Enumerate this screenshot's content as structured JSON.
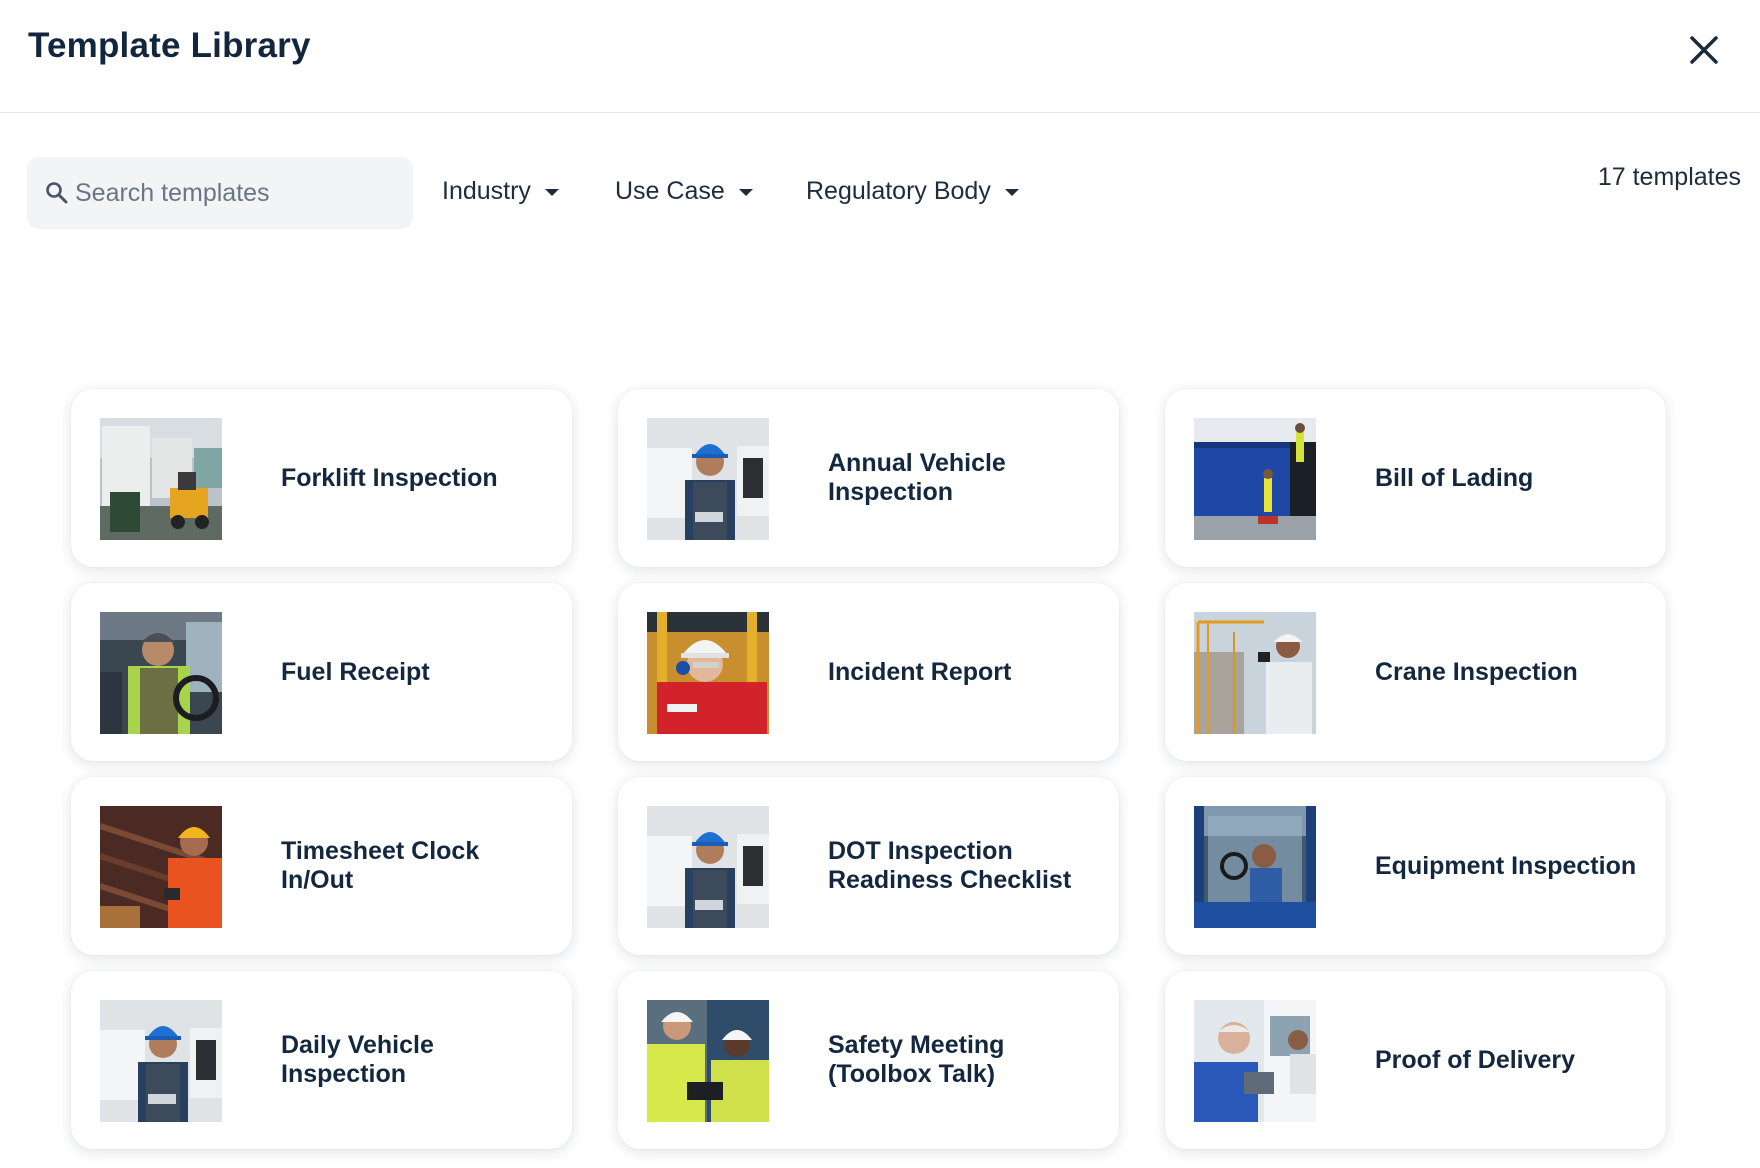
{
  "header": {
    "title": "Template Library"
  },
  "toolbar": {
    "search_placeholder": "Search templates",
    "search_value": "",
    "filters": [
      {
        "label": "Industry"
      },
      {
        "label": "Use Case"
      },
      {
        "label": "Regulatory Body"
      }
    ],
    "count_label": "17 templates"
  },
  "templates": [
    {
      "title": "Forklift Inspection",
      "image": "forklift-photo"
    },
    {
      "title": "Annual Vehicle Inspection",
      "image": "worker-hardhat-tablet-photo"
    },
    {
      "title": "Bill of Lading",
      "image": "truck-loading-photo"
    },
    {
      "title": "Fuel Receipt",
      "image": "truck-driver-photo"
    },
    {
      "title": "Incident Report",
      "image": "worker-red-jacket-photo"
    },
    {
      "title": "Crane Inspection",
      "image": "crane-site-photo"
    },
    {
      "title": "Timesheet Clock In/Out",
      "image": "worker-orange-photo"
    },
    {
      "title": "DOT Inspection Readiness Checklist",
      "image": "worker-hardhat-tablet-photo"
    },
    {
      "title": "Equipment Inspection",
      "image": "tractor-cab-photo"
    },
    {
      "title": "Daily Vehicle Inspection",
      "image": "worker-hardhat-tablet-photo"
    },
    {
      "title": "Safety Meeting (Toolbox Talk)",
      "image": "safety-meeting-photo"
    },
    {
      "title": "Proof of Delivery",
      "image": "delivery-photo"
    }
  ],
  "colors": {
    "title_text": "#13283f",
    "search_bg": "#f2f4f6",
    "divider": "#e3e7ec"
  }
}
